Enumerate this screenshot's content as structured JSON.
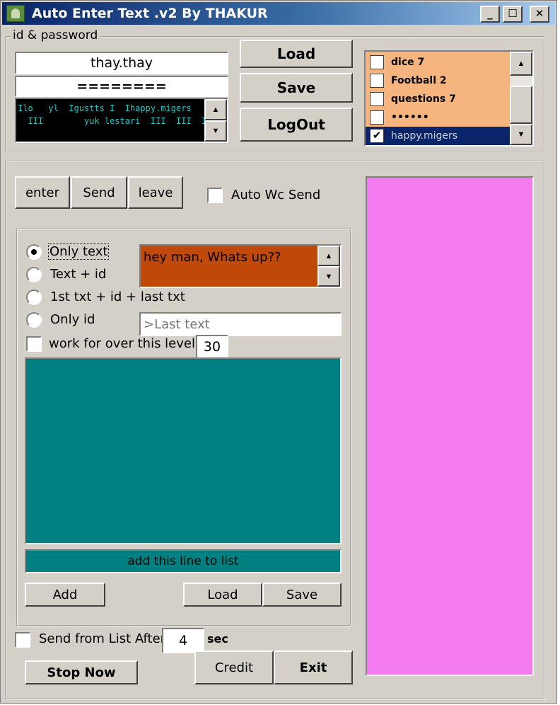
{
  "window": {
    "title": "Auto Enter Text .v2 By THAKUR",
    "minimize": "_",
    "maximize": "☐",
    "close": "✕"
  },
  "login": {
    "group_label": "id & password",
    "id_value": "thay.thay",
    "password_value": "========",
    "log_lines": [
      "Ilo   yl  Igustts I  Ihappy.migers",
      "  III        yuk lestari  III  III  III"
    ],
    "load_label": "Load",
    "save_label": "Save",
    "logout_label": "LogOut"
  },
  "id_list": {
    "items": [
      {
        "label": "dice 7",
        "checked": false
      },
      {
        "label": "Football 2",
        "checked": false
      },
      {
        "label": "questions 7",
        "checked": false
      },
      {
        "label": "••••••",
        "checked": false
      },
      {
        "label": "happy.migers",
        "checked": true,
        "selected": true
      }
    ]
  },
  "actions": {
    "enter_label": "enter",
    "send_label": "Send",
    "leave_label": "leave",
    "auto_wc_label": "Auto Wc Send",
    "auto_wc_checked": false
  },
  "mode": {
    "options": [
      {
        "label": "Only text",
        "selected": true
      },
      {
        "label": "Text + id",
        "selected": false
      },
      {
        "label": "1st txt + id + last txt",
        "selected": false
      },
      {
        "label": "Only id",
        "selected": false
      }
    ],
    "message_text": "hey man, Whats up??",
    "last_text_placeholder": ">Last text",
    "level_label": "work for over this level",
    "level_checked": false,
    "level_value": "30",
    "add_line_label": "add this line to list",
    "add_label": "Add",
    "list_load_label": "Load",
    "list_save_label": "Save"
  },
  "footer": {
    "send_from_list_label": "Send from List After",
    "send_from_list_checked": false,
    "interval_value": "4",
    "interval_unit": "sec",
    "stop_label": "Stop Now",
    "credit_label": "Credit",
    "exit_label": "Exit"
  },
  "colors": {
    "message_bg": "#c04808",
    "list_panel_bg": "#008080",
    "preview_bg": "#f47af0",
    "id_list_bg": "#f6b47e"
  }
}
